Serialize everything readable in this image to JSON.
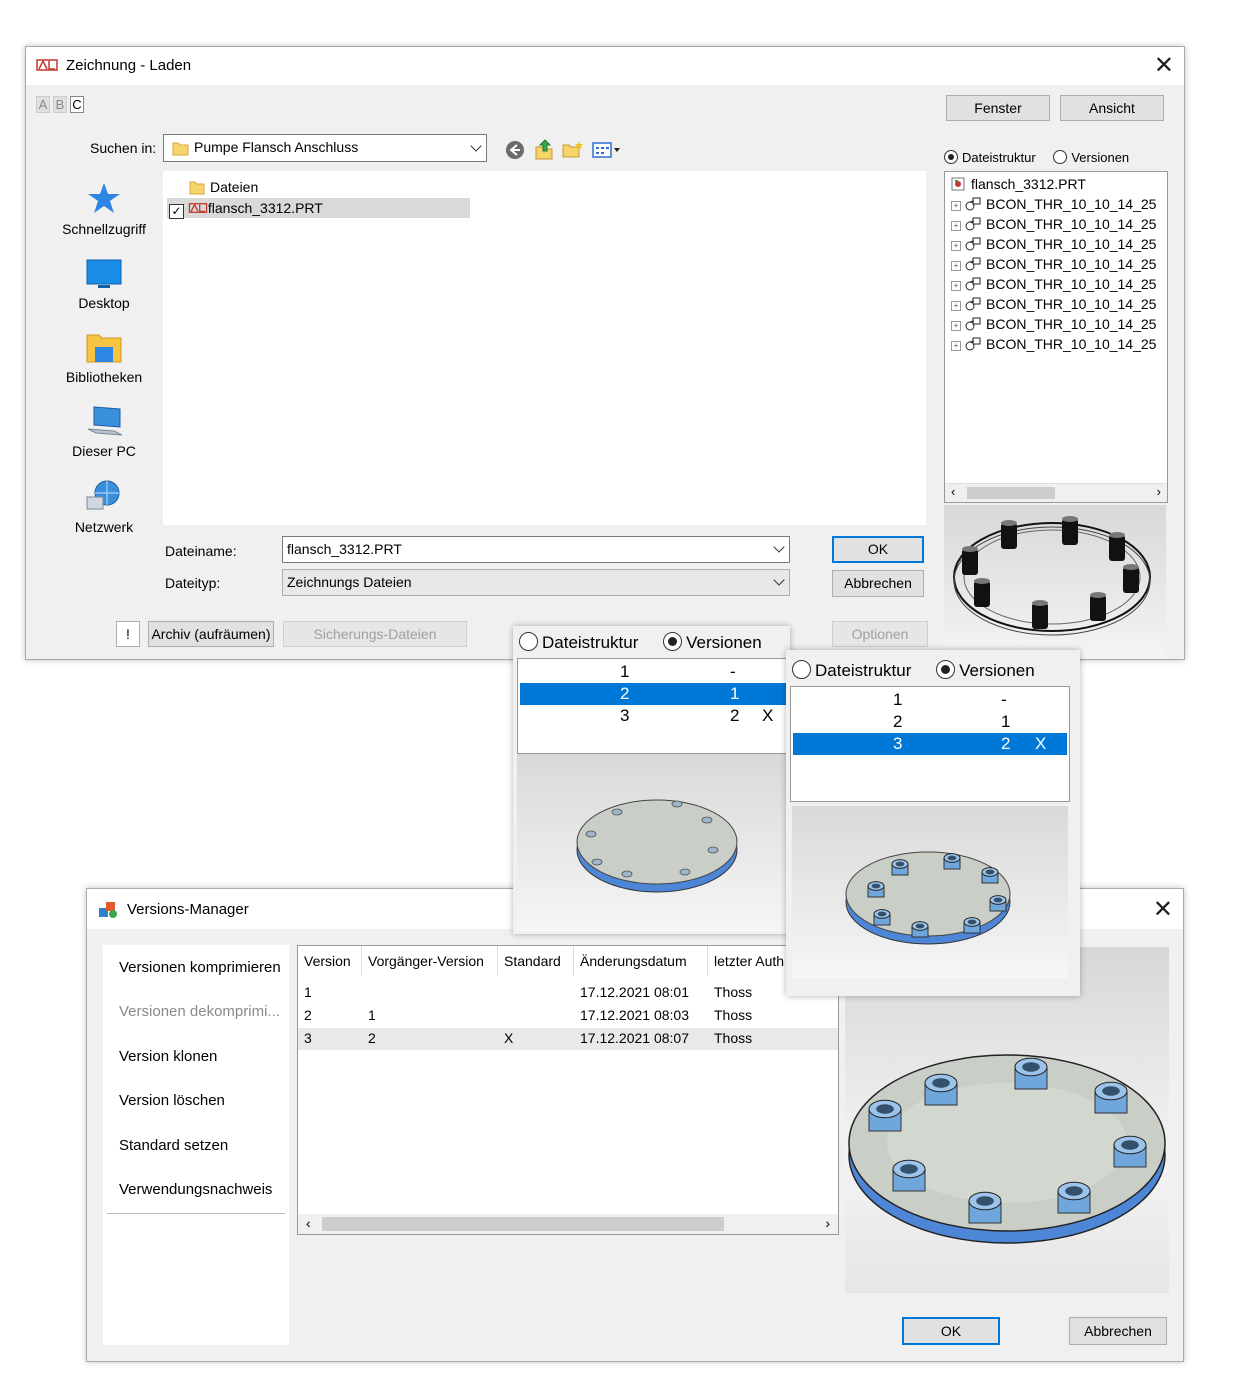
{
  "load_dialog": {
    "title": "Zeichnung - Laden",
    "abc": [
      "A",
      "B",
      "C"
    ],
    "fenster_label": "Fenster",
    "ansicht_label": "Ansicht",
    "suchen_label": "Suchen in:",
    "suchen_value": "Pumpe Flansch Anschluss",
    "nav_items": [
      {
        "label": "Schnellzugriff",
        "icon": "star-icon"
      },
      {
        "label": "Desktop",
        "icon": "desktop-icon"
      },
      {
        "label": "Bibliotheken",
        "icon": "library-folder-icon"
      },
      {
        "label": "Dieser PC",
        "icon": "computer-icon"
      },
      {
        "label": "Netzwerk",
        "icon": "network-icon"
      }
    ],
    "files": [
      {
        "name": "Dateien",
        "icon": "folder-icon"
      },
      {
        "name": "flansch_3312.PRT",
        "icon": "drawing-file-icon",
        "checked": true
      }
    ],
    "dateiname_label": "Dateiname:",
    "dateiname_value": "flansch_3312.PRT",
    "dateityp_label": "Dateityp:",
    "dateityp_value": "Zeichnungs Dateien",
    "ok_label": "OK",
    "abbrechen_label": "Abbrechen",
    "exclam_label": "!",
    "archiv_label": "Archiv (aufräumen)",
    "sicherung_label": "Sicherungs-Dateien",
    "optionen_label": "Optionen",
    "radio_dateistruktur": "Dateistruktur",
    "radio_versionen": "Versionen",
    "tree_root": "flansch_3312.PRT",
    "tree_children": [
      "BCON_THR_10_10_14_25",
      "BCON_THR_10_10_14_25",
      "BCON_THR_10_10_14_25",
      "BCON_THR_10_10_14_25",
      "BCON_THR_10_10_14_25",
      "BCON_THR_10_10_14_25",
      "BCON_THR_10_10_14_25",
      "BCON_THR_10_10_14_25"
    ]
  },
  "popup_a": {
    "radio_dateistruktur": "Dateistruktur",
    "radio_versionen": "Versionen",
    "rows": [
      {
        "v": "1",
        "p": "-",
        "x": ""
      },
      {
        "v": "2",
        "p": "1",
        "x": ""
      },
      {
        "v": "3",
        "p": "2",
        "x": "X"
      }
    ],
    "selected_index": 1
  },
  "popup_b": {
    "radio_dateistruktur": "Dateistruktur",
    "radio_versionen": "Versionen",
    "rows": [
      {
        "v": "1",
        "p": "-",
        "x": ""
      },
      {
        "v": "2",
        "p": "1",
        "x": ""
      },
      {
        "v": "3",
        "p": "2",
        "x": "X"
      }
    ],
    "selected_index": 2
  },
  "version_manager": {
    "title": "Versions-Manager",
    "menu": [
      {
        "label": "Versionen komprimieren",
        "enabled": true
      },
      {
        "label": "Versionen dekomprimi...",
        "enabled": false
      },
      {
        "label": "Version klonen",
        "enabled": true
      },
      {
        "label": "Version löschen",
        "enabled": true
      },
      {
        "label": "Standard setzen",
        "enabled": true
      },
      {
        "label": "Verwendungsnachweis",
        "enabled": true
      }
    ],
    "columns": [
      "Version",
      "Vorgänger-Version",
      "Standard",
      "Änderungsdatum",
      "letzter Auth"
    ],
    "rows": [
      [
        "1",
        "",
        "",
        "17.12.2021 08:01",
        "Thoss"
      ],
      [
        "2",
        "1",
        "",
        "17.12.2021 08:03",
        "Thoss"
      ],
      [
        "3",
        "2",
        "X",
        "17.12.2021 08:07",
        "Thoss"
      ]
    ],
    "ok_label": "OK",
    "abbrechen_label": "Abbrechen"
  },
  "colors": {
    "selection": "#0078d7",
    "window_bg": "#f0f0f0",
    "preview_bg": "#e4e6e4",
    "flange_plate": "#c9cec6",
    "flange_edge": "#5a8ed6"
  }
}
